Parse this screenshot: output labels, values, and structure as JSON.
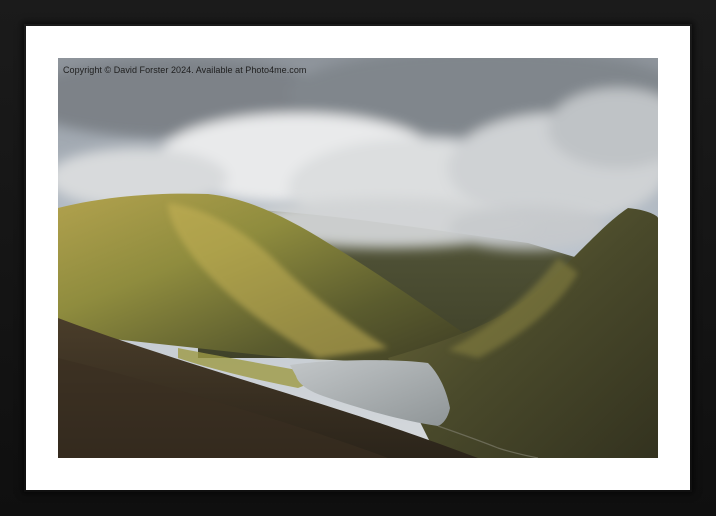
{
  "watermark": {
    "text": "Copyright © David Forster 2024. Available at Photo4me.com"
  },
  "colors": {
    "frame": "#141414",
    "mount": "#ffffff",
    "sky": "#aab4bf",
    "cloud": "#e8e8e8",
    "hill_sunlit": "#9a9146",
    "hill_shadow": "#3b3a26",
    "lake": "#a8adb0"
  }
}
